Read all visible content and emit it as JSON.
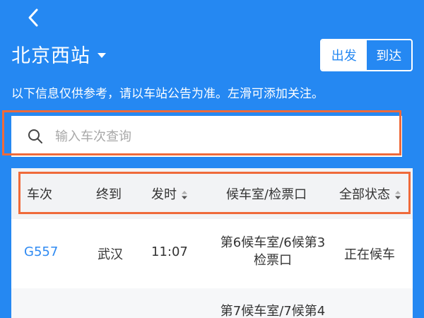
{
  "header": {
    "station_name": "北京西站",
    "notice": "以下信息仅供参考，请以车站公告为准。左滑可添加关注。"
  },
  "direction_toggle": {
    "departure_label": "出发",
    "arrival_label": "到达",
    "selected": "出发"
  },
  "search": {
    "placeholder": "输入车次查询"
  },
  "table": {
    "columns": {
      "train": "车次",
      "terminal": "终到",
      "depart_time": "发时",
      "waiting_gate": "候车室/检票口",
      "status": "全部状态"
    },
    "rows": [
      {
        "train": "G557",
        "terminal": "武汉",
        "depart_time": "11:07",
        "waiting_line1": "第6候车室/6候第3",
        "waiting_line2": "检票口",
        "status": "正在候车"
      },
      {
        "train": "",
        "terminal": "",
        "depart_time": "",
        "waiting_line1": "第7候车室/7候第4",
        "waiting_line2": "",
        "status": ""
      }
    ]
  },
  "colors": {
    "brand_blue": "#2588f2",
    "train_link": "#2f8af2",
    "highlight_orange": "#ef6a3a"
  },
  "icons": {
    "back": "chevron-left-icon",
    "dropdown": "caret-down-icon",
    "search": "search-icon",
    "sort": "sort-icon"
  }
}
